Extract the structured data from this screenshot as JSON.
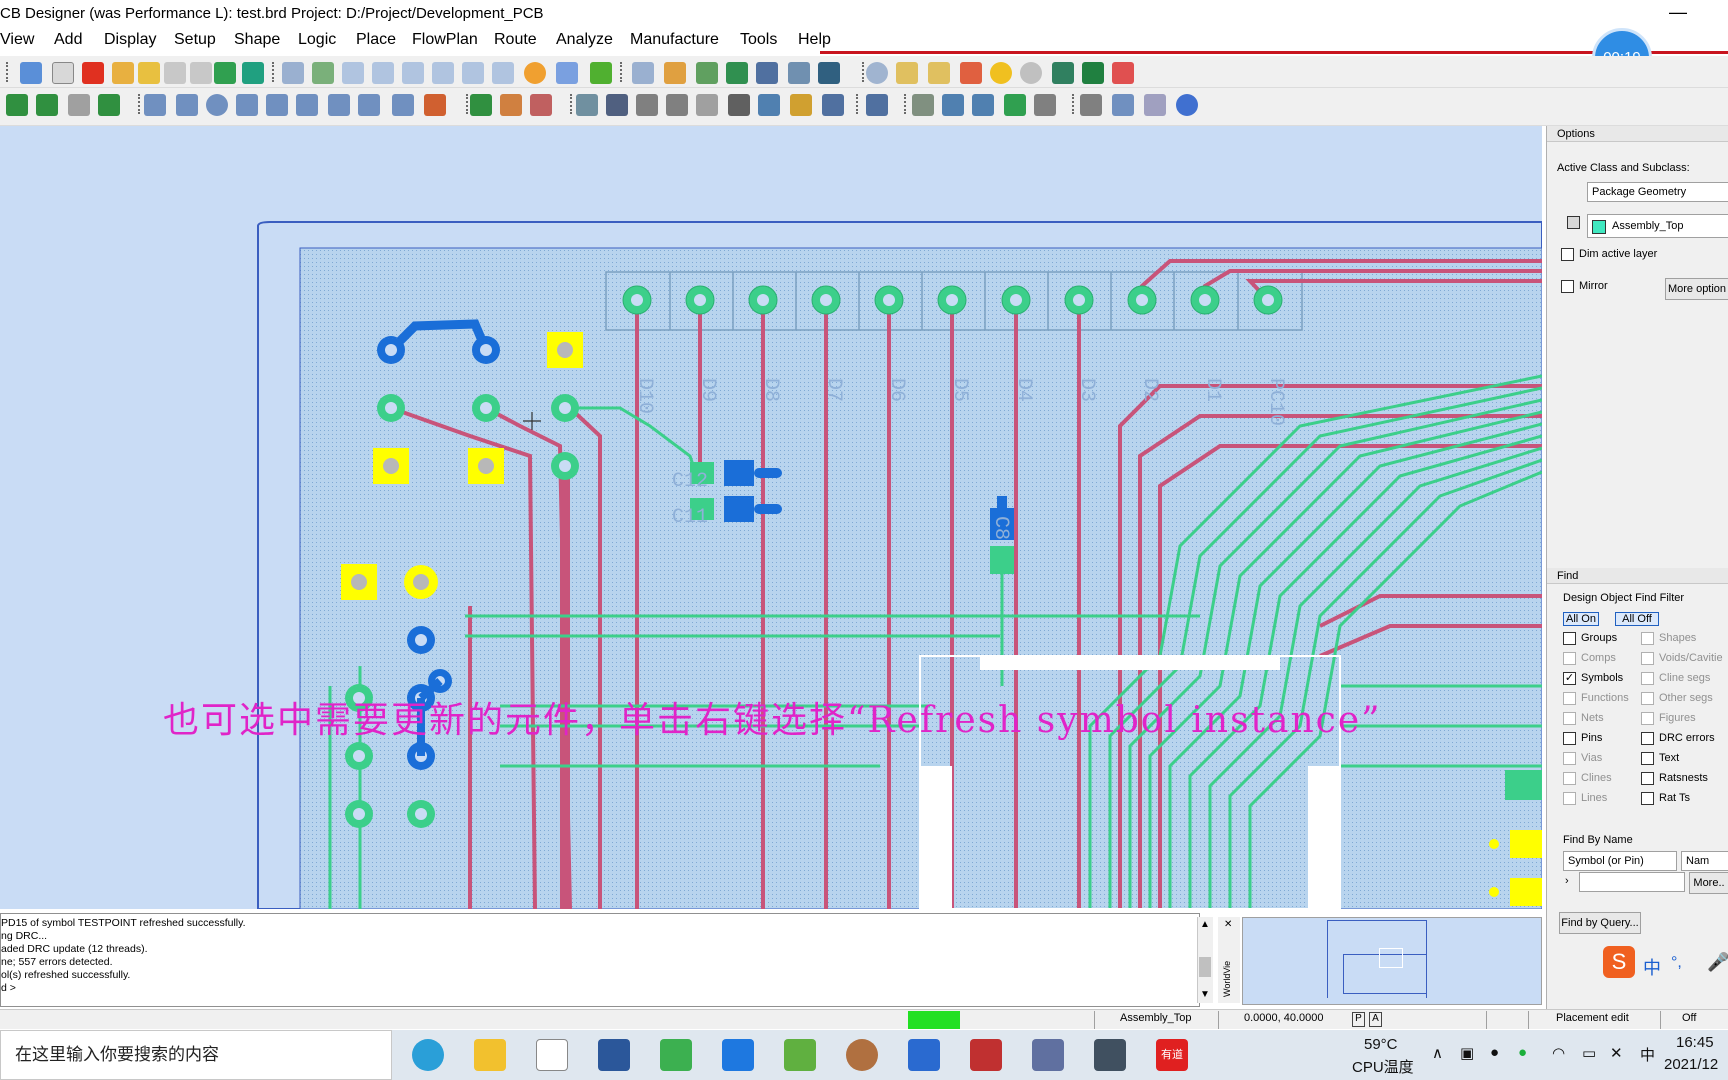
{
  "window": {
    "title": "CB Designer (was Performance L): test.brd  Project: D:/Project/Development_PCB",
    "minimize": "—"
  },
  "timer": "00:19",
  "menu": [
    "View",
    "Add",
    "Display",
    "Setup",
    "Shape",
    "Logic",
    "Place",
    "FlowPlan",
    "Route",
    "Analyze",
    "Manufacture",
    "Tools",
    "Help"
  ],
  "board": {
    "header_pins": [
      "D10",
      "D9",
      "D8",
      "D7",
      "D6",
      "D5",
      "D4",
      "D3",
      "D2",
      "D1",
      "PC10"
    ],
    "labels": [
      "C12",
      "C11",
      "C8"
    ],
    "cursor_icon": "crosshair-cursor-icon"
  },
  "overlay_caption": "也可选中需要更新的元件，单击右键选择“Refresh symbol instance”",
  "options_panel": {
    "header": "Options",
    "active_class_label": "Active Class and Subclass:",
    "class_value": "Package Geometry",
    "subclass_value": "Assembly_Top",
    "dim_active_layer": "Dim active layer",
    "mirror": "Mirror",
    "more_options": "More option"
  },
  "find_panel": {
    "header": "Find",
    "filter_title": "Design Object Find Filter",
    "all_on": "All On",
    "all_off": "All Off",
    "left_items": [
      {
        "label": "Groups",
        "checked": false,
        "enabled": true
      },
      {
        "label": "Comps",
        "checked": false,
        "enabled": false
      },
      {
        "label": "Symbols",
        "checked": true,
        "enabled": true
      },
      {
        "label": "Functions",
        "checked": false,
        "enabled": false
      },
      {
        "label": "Nets",
        "checked": false,
        "enabled": false
      },
      {
        "label": "Pins",
        "checked": false,
        "enabled": true
      },
      {
        "label": "Vias",
        "checked": false,
        "enabled": false
      },
      {
        "label": "Clines",
        "checked": false,
        "enabled": false
      },
      {
        "label": "Lines",
        "checked": false,
        "enabled": false
      }
    ],
    "right_items": [
      {
        "label": "Shapes",
        "checked": false,
        "enabled": false
      },
      {
        "label": "Voids/Cavitie",
        "checked": false,
        "enabled": false
      },
      {
        "label": "Cline segs",
        "checked": false,
        "enabled": false
      },
      {
        "label": "Other segs",
        "checked": false,
        "enabled": false
      },
      {
        "label": "Figures",
        "checked": false,
        "enabled": false
      },
      {
        "label": "DRC errors",
        "checked": false,
        "enabled": true
      },
      {
        "label": "Text",
        "checked": false,
        "enabled": true
      },
      {
        "label": "Ratsnests",
        "checked": false,
        "enabled": true
      },
      {
        "label": "Rat Ts",
        "checked": false,
        "enabled": true
      }
    ],
    "find_by_name": "Find By Name",
    "name_type": "Symbol (or Pin)",
    "name_mode": "Nam",
    "more_button": "More..",
    "find_by_query": "Find by Query..."
  },
  "command_window": {
    "lines": [
      "PD15 of symbol TESTPOINT refreshed successfully.",
      "ng DRC...",
      "aded DRC update (12 threads).",
      "ne; 557 errors detected.",
      "ol(s) refreshed successfully.",
      "d >"
    ],
    "worldview_label": "WorldVie"
  },
  "status_bar": {
    "layer": "Assembly_Top",
    "coords": "0.0000, 40.0000",
    "p": "P",
    "a": "A",
    "mode": "Placement edit",
    "off": "Off"
  },
  "taskbar": {
    "search_placeholder": "在这里输入你要搜索的内容",
    "temperature": "59°C",
    "cpu_label": "CPU温度",
    "time": "16:45",
    "date": "2021/12",
    "ime_cn": "中",
    "ime_punct": "°,",
    "youdao": "有道"
  },
  "colors": {
    "canvas_bg": "#c9dcf5",
    "board_fill": "#a9cbe8",
    "trace_red": "#c8547a",
    "trace_green": "#3ccf8a",
    "pad_yellow": "#ffff00",
    "pad_blue": "#1a6ed8",
    "overlay_magenta": "#e024c8",
    "timer_blue": "#2f8de4"
  }
}
